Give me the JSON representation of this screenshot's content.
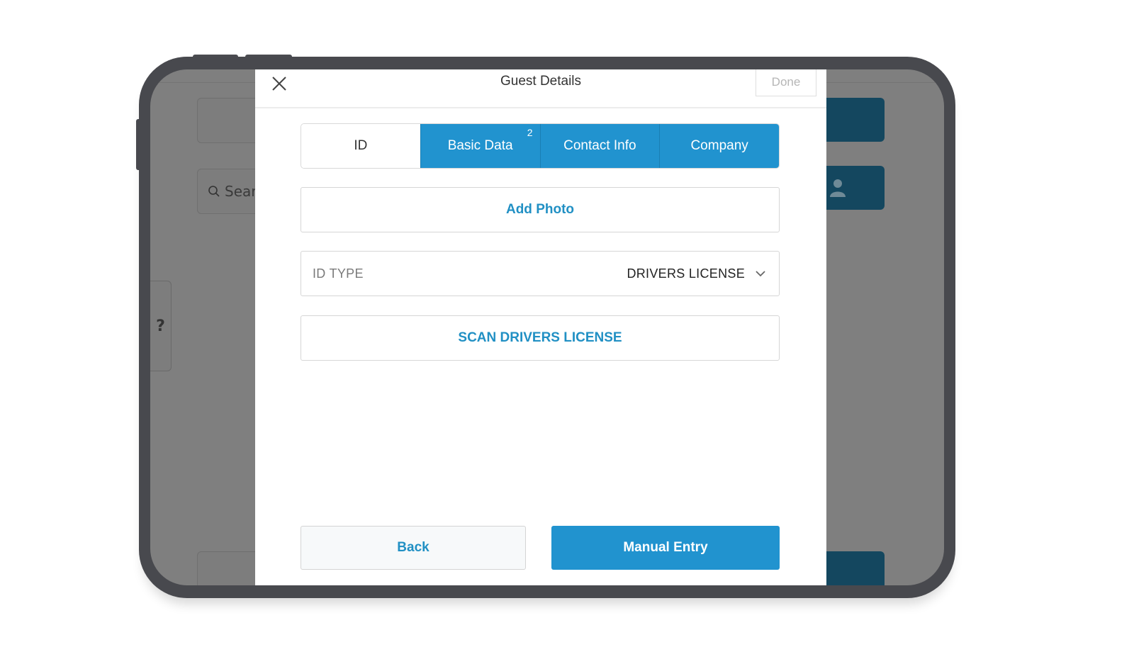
{
  "background": {
    "search_text": "Searc",
    "help_text": "?"
  },
  "modal": {
    "title": "Guest Details",
    "done_label": "Done",
    "tabs": [
      {
        "label": "ID",
        "badge": ""
      },
      {
        "label": "Basic Data",
        "badge": "2"
      },
      {
        "label": "Contact Info",
        "badge": ""
      },
      {
        "label": "Company",
        "badge": ""
      }
    ],
    "active_tab": "ID",
    "add_photo_label": "Add Photo",
    "id_type": {
      "label": "ID TYPE",
      "value": "DRIVERS LICENSE"
    },
    "scan_label": "SCAN DRIVERS LICENSE",
    "back_label": "Back",
    "manual_entry_label": "Manual Entry"
  },
  "colors": {
    "accent": "#2193cf",
    "link": "#2190c4",
    "frame": "#48494e",
    "overlay": "#7f7f7f",
    "background_button": "#14475f"
  }
}
